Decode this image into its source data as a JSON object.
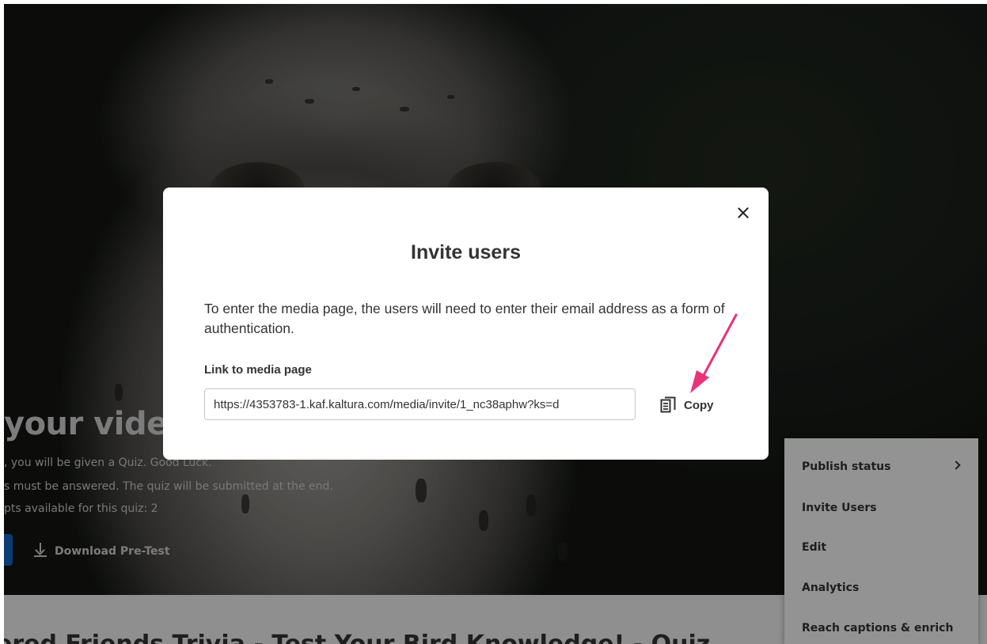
{
  "page": {
    "hero_title": "your video",
    "hero_lines": [
      ", you will be given a Quiz. Good Luck.",
      "s must be answered. The quiz will be submitted at the end.",
      "pts available for this quiz: 2"
    ],
    "download_label": "Download Pre-Test",
    "media_title": "ered Friends Trivia - Test Your Bird Knowledge! - Quiz"
  },
  "actions_menu": {
    "items": [
      {
        "label": "Publish status",
        "has_submenu": true
      },
      {
        "label": "Invite Users"
      },
      {
        "label": "Edit"
      },
      {
        "label": "Analytics"
      },
      {
        "label": "Reach captions & enrich"
      }
    ]
  },
  "modal": {
    "title": "Invite users",
    "description": "To enter the media page, the users will need to enter their email address as a form of authentication.",
    "field_label": "Link to media page",
    "link_value": "https://4353783-1.kaf.kaltura.com/media/invite/1_nc38aphw?ks=d",
    "copy_label": "Copy",
    "close_icon": "close-icon",
    "copy_icon": "copy-icon"
  },
  "colors": {
    "annotation_arrow": "#e8337a",
    "primary_button": "#1565c0"
  }
}
